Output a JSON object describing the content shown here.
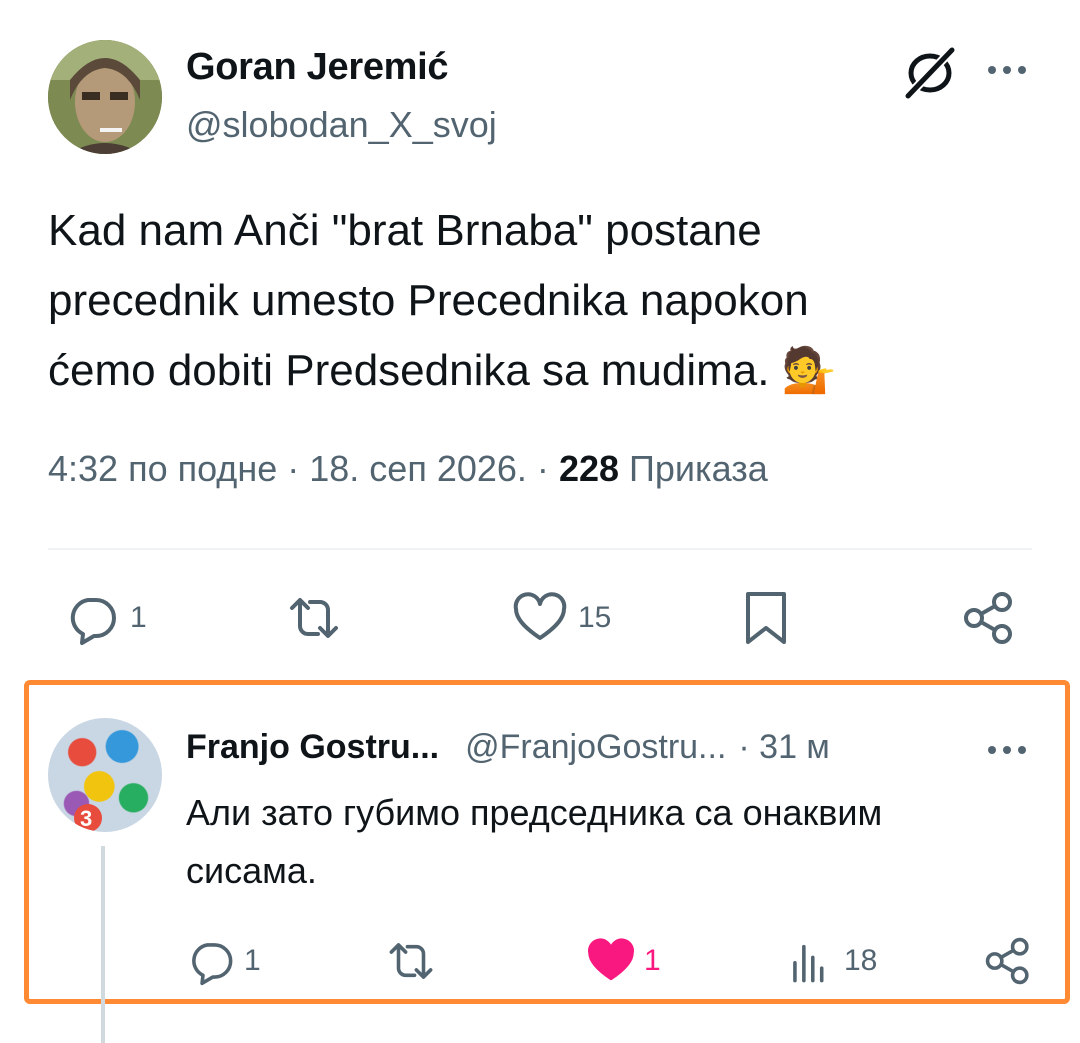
{
  "tweet": {
    "author_name": "Goran Jeremić",
    "author_handle": "@slobodan_X_svoj",
    "text_line1": "Kad nam Anči \"brat Brnaba\" postane",
    "text_line2": "precednik umesto Precednika napokon",
    "text_line3": "ćemo dobiti Predsednika sa mudima.",
    "emoji": "💁",
    "time": "4:32 по подне",
    "date": "18. сеп 2026.",
    "views_count": "228",
    "views_label": "Приказа",
    "separator": "·",
    "actions": {
      "reply_count": "1",
      "like_count": "15"
    },
    "icons": [
      "grok-icon",
      "more-icon",
      "reply-icon",
      "retweet-icon",
      "like-icon",
      "bookmark-icon",
      "share-icon"
    ]
  },
  "reply": {
    "author_name": "Franjo Gostru...",
    "author_handle": "@FranjoGostru...",
    "time": "· 31 м",
    "text_line1": "Али зато губимо председника са онаквим",
    "text_line2": "сисама.",
    "actions": {
      "reply_count": "1",
      "like_count": "1",
      "views_count": "18"
    },
    "colors": {
      "like": "#f91880",
      "highlight_border": "#ff8a33"
    }
  }
}
